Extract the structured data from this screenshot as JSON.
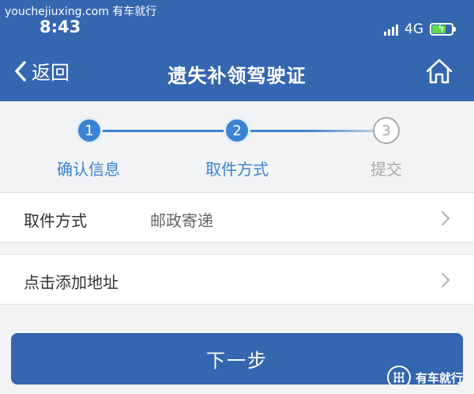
{
  "watermark": {
    "text": "youchejiuxing.com 有车就行",
    "logo_text": "有车就行"
  },
  "status_bar": {
    "time": "8:43",
    "network": "4G",
    "battery_level": 0.7
  },
  "nav": {
    "back_label": "返回",
    "title": "遗失补领驾驶证"
  },
  "steps": [
    {
      "number": "1",
      "label": "确认信息",
      "state": "done"
    },
    {
      "number": "2",
      "label": "取件方式",
      "state": "current"
    },
    {
      "number": "3",
      "label": "提交",
      "state": "todo"
    }
  ],
  "pickup_row": {
    "label": "取件方式",
    "value": "邮政寄递"
  },
  "address_row": {
    "label": "点击添加地址"
  },
  "next_button": {
    "label": "下一步"
  },
  "colors": {
    "primary": "#3566b0",
    "step_active": "#3b84d3",
    "step_inactive": "#aaaaaa",
    "background": "#f2f3f5"
  }
}
